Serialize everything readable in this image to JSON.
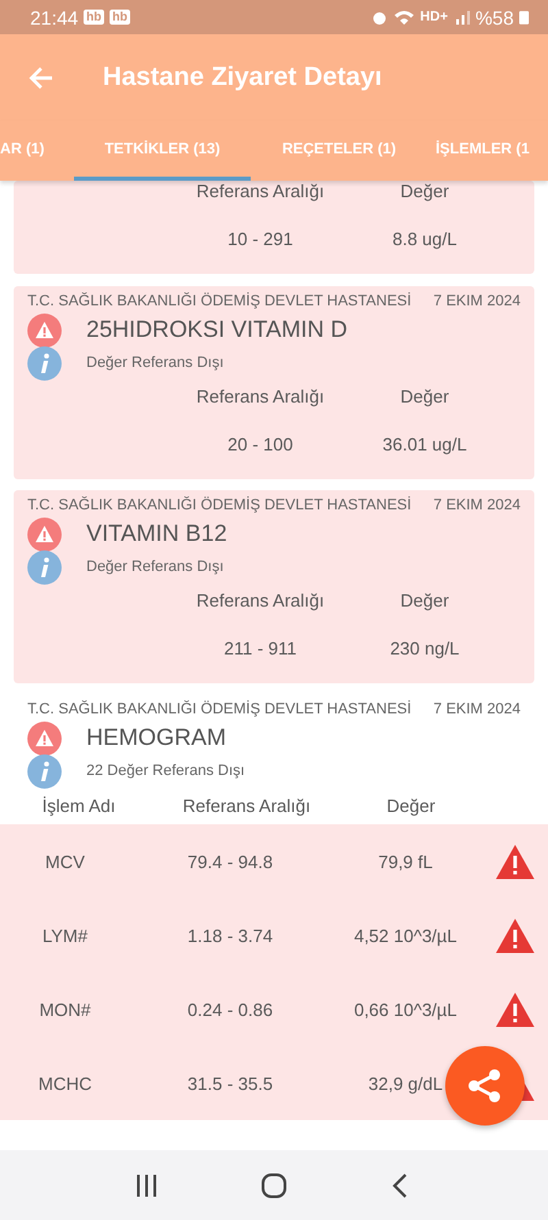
{
  "status_bar": {
    "time": "21:44",
    "badges": [
      "hb",
      "hb"
    ],
    "network": "HD+",
    "battery": "%58"
  },
  "app_bar": {
    "title": "Hastane Ziyaret Detayı"
  },
  "tabs": [
    {
      "label": "AR (1)",
      "selected": false
    },
    {
      "label": "TETKİKLER (13)",
      "selected": true
    },
    {
      "label": "REÇETELER (1)",
      "selected": false
    },
    {
      "label": "İŞLEMLER (1",
      "selected": false
    }
  ],
  "tests": [
    {
      "kind": "partial",
      "range_label": "Referans Aralığı",
      "value_label": "Değer",
      "range": "10 - 291",
      "value": "8.8 ug/L"
    },
    {
      "kind": "single",
      "hospital": "T.C. SAĞLIK BAKANLIĞI ÖDEMİŞ DEVLET HASTANESİ",
      "date": "7 EKIM 2024",
      "name": "25HIDROKSI VITAMIN D",
      "note": "Değer Referans Dışı",
      "range_label": "Referans Aralığı",
      "value_label": "Değer",
      "range": "20 - 100",
      "value": "36.01 ug/L"
    },
    {
      "kind": "single",
      "hospital": "T.C. SAĞLIK BAKANLIĞI ÖDEMİŞ DEVLET HASTANESİ",
      "date": "7 EKIM 2024",
      "name": "VITAMIN B12",
      "note": "Değer Referans Dışı",
      "range_label": "Referans Aralığı",
      "value_label": "Değer",
      "range": "211 - 911",
      "value": "230 ng/L"
    },
    {
      "kind": "panel",
      "hospital": "T.C. SAĞLIK BAKANLIĞI ÖDEMİŞ DEVLET HASTANESİ",
      "date": "7 EKIM 2024",
      "name": "HEMOGRAM",
      "note": "22 Değer Referans Dışı",
      "columns": [
        "İşlem Adı",
        "Referans Aralığı",
        "Değer"
      ],
      "rows": [
        {
          "name": "MCV",
          "range": "79.4 - 94.8",
          "value": "79,9 fL",
          "out_of_range": true
        },
        {
          "name": "LYM#",
          "range": "1.18 - 3.74",
          "value": "4,52 10^3/µL",
          "out_of_range": true
        },
        {
          "name": "MON#",
          "range": "0.24 - 0.86",
          "value": "0,66 10^3/µL",
          "out_of_range": true
        },
        {
          "name": "MCHC",
          "range": "31.5 - 35.5",
          "value": "32,9 g/dL",
          "out_of_range": true
        }
      ]
    }
  ]
}
